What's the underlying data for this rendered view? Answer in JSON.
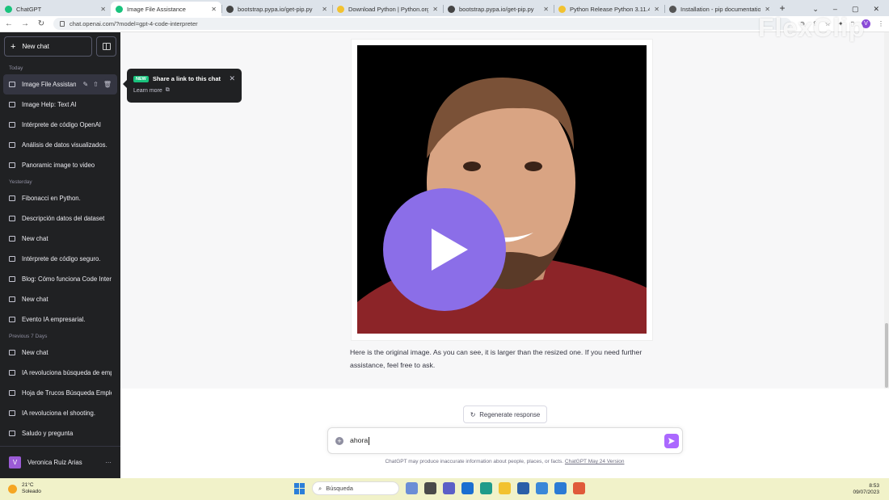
{
  "browser": {
    "tabs": [
      {
        "title": "ChatGPT",
        "color": "#19c37d",
        "active": false
      },
      {
        "title": "Image File Assistance",
        "color": "#19c37d",
        "active": true
      },
      {
        "title": "bootstrap.pypa.io/get-pip.py",
        "color": "#444444",
        "active": false
      },
      {
        "title": "Download Python | Python.org",
        "color": "#f2c230",
        "active": false
      },
      {
        "title": "bootstrap.pypa.io/get-pip.py",
        "color": "#444444",
        "active": false
      },
      {
        "title": "Python Release Python 3.11.4 |",
        "color": "#f2c230",
        "active": false
      },
      {
        "title": "Installation - pip documentatio",
        "color": "#555555",
        "active": false
      }
    ],
    "url": "chat.openai.com/?model=gpt-4-code-interpreter",
    "profile_initial": "V"
  },
  "sidebar": {
    "new_chat": "New chat",
    "sections": [
      {
        "label": "Today",
        "items": [
          {
            "label": "Image File Assistance",
            "active": true
          },
          {
            "label": "Image Help: Text AI"
          },
          {
            "label": "Intérprete de código OpenAI"
          },
          {
            "label": "Análisis de datos visualizados."
          },
          {
            "label": "Panoramic image to video"
          }
        ]
      },
      {
        "label": "Yesterday",
        "items": [
          {
            "label": "Fibonacci en Python."
          },
          {
            "label": "Descripción datos del dataset"
          },
          {
            "label": "New chat"
          },
          {
            "label": "Intérprete de código seguro."
          },
          {
            "label": "Blog: Cómo funciona Code Interpreter"
          },
          {
            "label": "New chat"
          },
          {
            "label": "Evento IA empresarial."
          }
        ]
      },
      {
        "label": "Previous 7 Days",
        "items": [
          {
            "label": "New chat"
          },
          {
            "label": "IA revoluciona búsqueda de empleo"
          },
          {
            "label": "Hoja de Trucos Búsqueda Empleo"
          },
          {
            "label": "IA revoluciona el shooting."
          },
          {
            "label": "Saludo y pregunta"
          }
        ]
      }
    ],
    "user": {
      "name": "Veronica Ruiz Arias",
      "initial": "V"
    }
  },
  "tooltip": {
    "badge": "NEW",
    "title": "Share a link to this chat",
    "link": "Learn more"
  },
  "chat": {
    "message": "Here is the original image. As you can see, it is larger than the resized one. If you need further assistance, feel free to ask.",
    "regenerate": "Regenerate response",
    "input_value": "ahora",
    "disclaimer": "ChatGPT may produce inaccurate information about people, places, or facts.",
    "disclaimer_link": "ChatGPT May 24 Version"
  },
  "overlay": {
    "watermark": "FlexClip"
  },
  "taskbar": {
    "temp": "21°C",
    "weather": "Soleado",
    "search": "Búsqueda",
    "time": "8:53",
    "date": "09/07/2023"
  }
}
